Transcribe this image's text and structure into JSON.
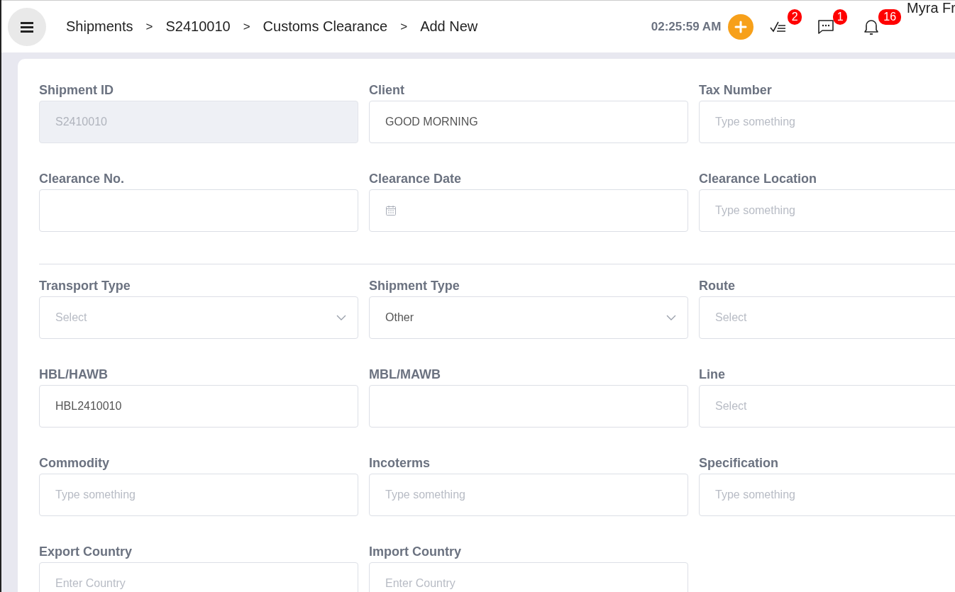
{
  "header": {
    "breadcrumbs": [
      "Shipments",
      "S2410010",
      "Customs Clearance",
      "Add New"
    ],
    "separator": ">",
    "time": "02:25:59 AM",
    "badges": {
      "tasks": "2",
      "messages": "1",
      "notifications": "16"
    },
    "user_name": "Myra Fr"
  },
  "sections": [
    {
      "fields": [
        {
          "label": "Shipment ID",
          "kind": "text",
          "value": "S2410010",
          "disabled": true
        },
        {
          "label": "Client",
          "kind": "text",
          "value": "GOOD MORNING",
          "disabled": false
        },
        {
          "label": "Tax Number",
          "kind": "text",
          "placeholder": "Type something",
          "disabled": false
        },
        {
          "label": "Clearance No.",
          "kind": "text",
          "disabled": false
        },
        {
          "label": "Clearance Date",
          "kind": "date",
          "disabled": false
        },
        {
          "label": "Clearance Location",
          "kind": "text",
          "placeholder": "Type something",
          "disabled": false
        }
      ]
    },
    {
      "fields": [
        {
          "label": "Transport Type",
          "kind": "select",
          "placeholder": "Select",
          "disabled": false
        },
        {
          "label": "Shipment Type",
          "kind": "select",
          "value": "Other",
          "disabled": false
        },
        {
          "label": "Route",
          "kind": "text",
          "placeholder": "Select",
          "disabled": false
        },
        {
          "label": "HBL/HAWB",
          "kind": "text",
          "value": "HBL2410010",
          "disabled": false
        },
        {
          "label": "MBL/MAWB",
          "kind": "text",
          "disabled": false
        },
        {
          "label": "Line",
          "kind": "text",
          "placeholder": "Select",
          "disabled": false
        },
        {
          "label": "Commodity",
          "kind": "text",
          "placeholder": "Type something",
          "disabled": false
        },
        {
          "label": "Incoterms",
          "kind": "text",
          "placeholder": "Type something",
          "disabled": false
        },
        {
          "label": "Specification",
          "kind": "text",
          "placeholder": "Type something",
          "disabled": false
        },
        {
          "label": "Export Country",
          "kind": "text",
          "placeholder": "Enter Country",
          "disabled": false
        },
        {
          "label": "Import Country",
          "kind": "text",
          "placeholder": "Enter Country",
          "disabled": false
        }
      ]
    }
  ]
}
